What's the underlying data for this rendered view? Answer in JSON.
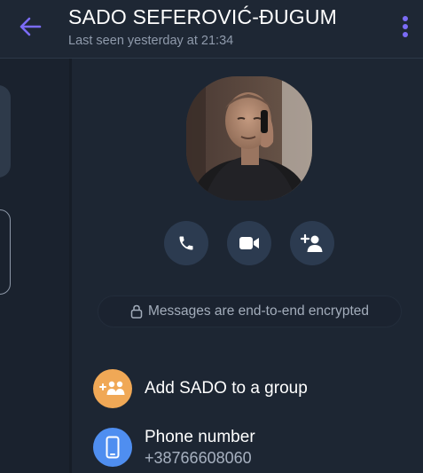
{
  "header": {
    "contact_name": "SADO SEFEROVIĆ-ĐUGUM",
    "last_seen": "Last seen yesterday at 21:34",
    "back_icon": "arrow-left-icon",
    "menu_icon": "more-vertical-icon",
    "accent_color": "#7b6cf6"
  },
  "profile": {
    "avatar_alt": "profile photo",
    "actions": [
      {
        "name": "voice-call",
        "icon": "phone-icon"
      },
      {
        "name": "video-call",
        "icon": "video-camera-icon"
      },
      {
        "name": "add-participant",
        "icon": "add-person-icon"
      }
    ],
    "encryption_notice": "Messages are end-to-end encrypted",
    "encryption_icon": "lock-icon"
  },
  "actions": {
    "add_to_group": {
      "label": "Add SADO to a group",
      "icon": "group-add-icon",
      "color": "#f0a856"
    },
    "phone": {
      "label": "Phone number",
      "value": "+38766608060",
      "icon": "mobile-phone-icon",
      "color": "#4f8ef0"
    }
  }
}
